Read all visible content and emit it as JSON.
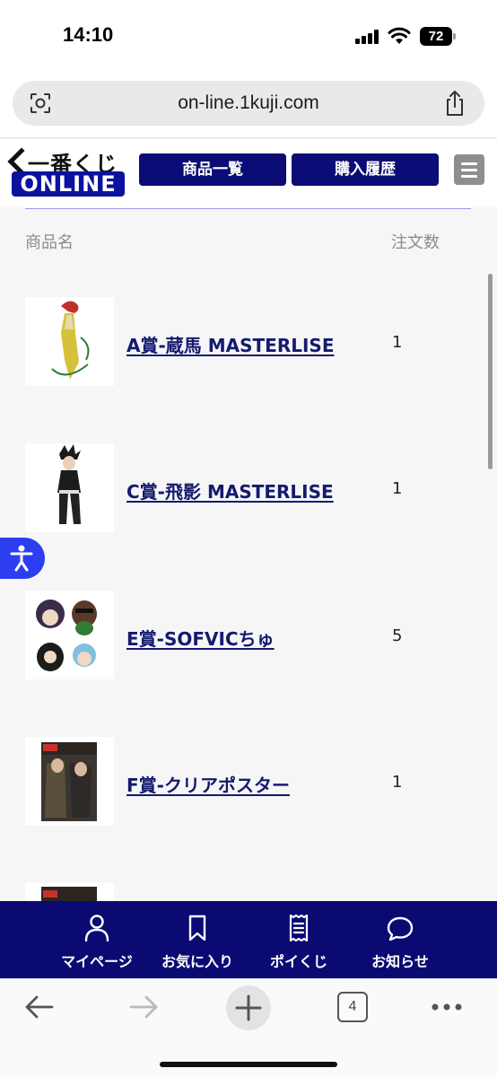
{
  "status_bar": {
    "time": "14:10",
    "battery": "72"
  },
  "browser": {
    "url": "on-line.1kuji.com",
    "tab_count": "4"
  },
  "header": {
    "logo_top": "一番くじ",
    "logo_bottom": "ONLINE",
    "nav_products": "商品一覧",
    "nav_history": "購入履歴"
  },
  "table": {
    "col_name": "商品名",
    "col_count": "注文数",
    "rows": [
      {
        "name": "A賞-蔵馬 MASTERLISE",
        "count": "1"
      },
      {
        "name": "C賞-飛影 MASTERLISE",
        "count": "1"
      },
      {
        "name": "E賞-SOFVICちゅ",
        "count": "5"
      },
      {
        "name": "F賞-クリアポスター",
        "count": "1"
      }
    ]
  },
  "bottom_nav": {
    "mypage": "マイページ",
    "favorites": "お気に入り",
    "poikuji": "ポイくじ",
    "news": "お知らせ"
  },
  "colors": {
    "brand_navy": "#0b0c75",
    "link": "#141a6e",
    "a11y_blue": "#2d3ef0"
  }
}
